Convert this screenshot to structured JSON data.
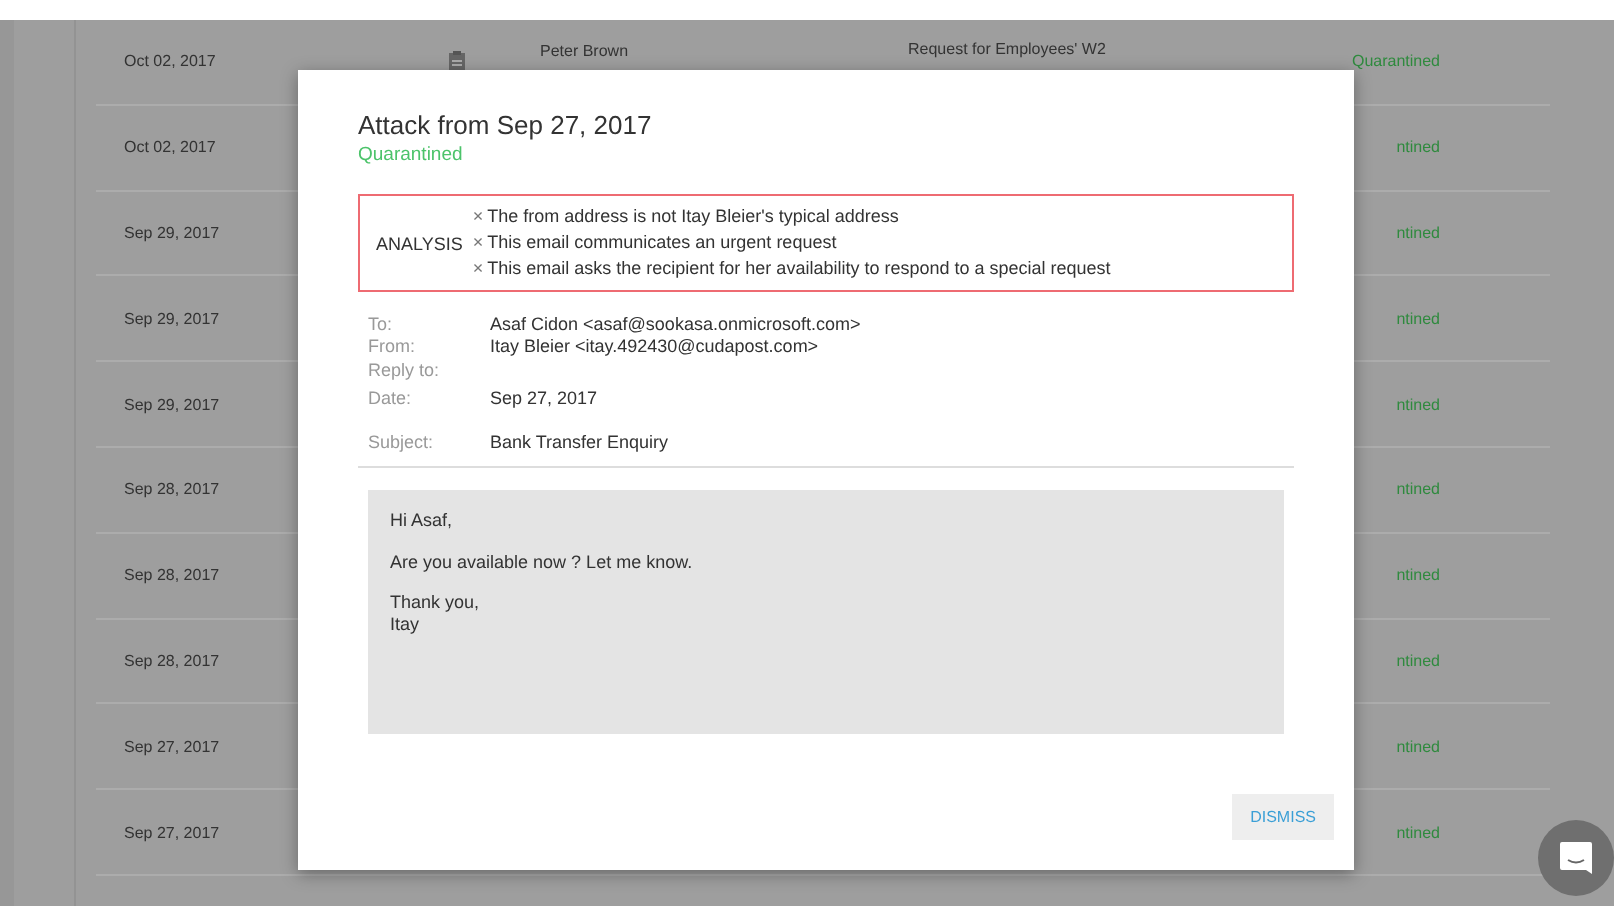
{
  "table": {
    "rows": [
      {
        "date": "Oct 02, 2017",
        "sender": "Peter Brown",
        "subject": "Request for Employees' W2",
        "status": "Quarantined"
      },
      {
        "date": "Oct 02, 2017",
        "status": "ntined"
      },
      {
        "date": "Sep 29, 2017",
        "status": "ntined"
      },
      {
        "date": "Sep 29, 2017",
        "status": "ntined"
      },
      {
        "date": "Sep 29, 2017",
        "status": "ntined"
      },
      {
        "date": "Sep 28, 2017",
        "status": "ntined"
      },
      {
        "date": "Sep 28, 2017",
        "status": "ntined"
      },
      {
        "date": "Sep 28, 2017",
        "status": "ntined"
      },
      {
        "date": "Sep 27, 2017",
        "status": "ntined"
      },
      {
        "date": "Sep 27, 2017",
        "status": "ntined"
      }
    ]
  },
  "modal": {
    "title": "Attack from Sep 27, 2017",
    "status": "Quarantined",
    "analysis": {
      "label": "ANALYSIS",
      "mark": "×",
      "findings": [
        "The from address is not Itay Bleier's typical address",
        "This email communicates an urgent request",
        "This email asks the recipient for her availability to respond to a special request"
      ]
    },
    "headers": [
      {
        "label": "To:",
        "value": "Asaf Cidon <asaf@sookasa.onmicrosoft.com>"
      },
      {
        "label": "From:",
        "value": "Itay Bleier <itay.492430@cudapost.com>"
      },
      {
        "label": "Reply to:"
      },
      {
        "label": "Date:",
        "value": "Sep 27, 2017"
      },
      {
        "label": "Subject:",
        "value": "Bank Transfer Enquiry"
      }
    ],
    "body": [
      "Hi Asaf,",
      "Are you available now ? Let me know.",
      "Thank you,\nItay"
    ],
    "button": "DISMISS"
  }
}
